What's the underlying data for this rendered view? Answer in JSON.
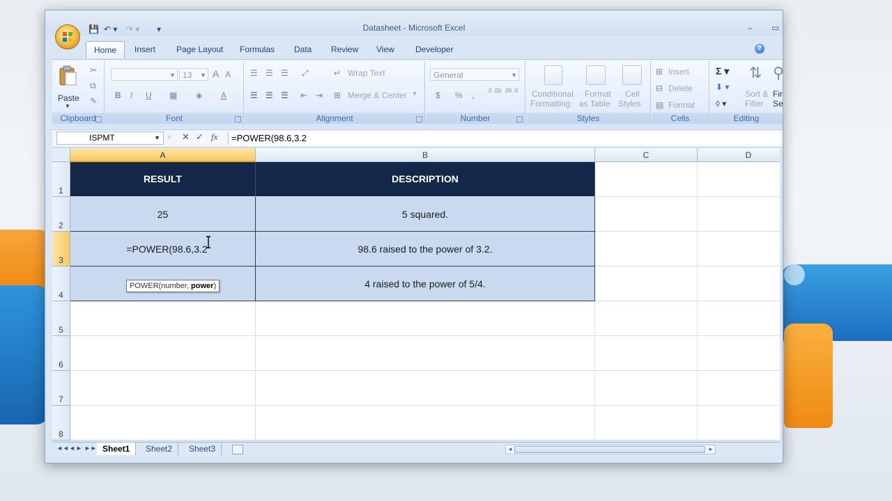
{
  "window": {
    "title": "Datasheet - Microsoft Excel",
    "minimize": "–",
    "maximize": "▭"
  },
  "qat": {
    "save": "💾",
    "undo": "↶ ▾",
    "redo": "↷ ▾",
    "more": "▾"
  },
  "tabs": [
    "Home",
    "Insert",
    "Page Layout",
    "Formulas",
    "Data",
    "Review",
    "View",
    "Developer"
  ],
  "help": "?",
  "ribbon": {
    "clipboard": {
      "label": "Clipboard",
      "paste": "Paste"
    },
    "font": {
      "label": "Font",
      "size": "13",
      "bold": "B",
      "italic": "I",
      "underline": "U",
      "grow": "A",
      "shrink": "A",
      "color": "A"
    },
    "alignment": {
      "label": "Alignment",
      "wrap_text": "Wrap Text",
      "merge_center": "Merge & Center"
    },
    "number": {
      "label": "Number",
      "format": "General",
      "currency": "$",
      "percent": "%",
      "comma": ",",
      "inc_dec": ".0 .00",
      "dec_dec": ".00 .0"
    },
    "styles": {
      "label": "Styles",
      "conditional": [
        "Conditional",
        "Formatting"
      ],
      "format_table": [
        "Format",
        "as Table"
      ],
      "cell_styles": [
        "Cell",
        "Styles"
      ]
    },
    "cells": {
      "label": "Cells",
      "insert": "Insert",
      "delete": "Delete",
      "format": "Format"
    },
    "editing": {
      "label": "Editing",
      "sort_filter": [
        "Sort &",
        "Filter"
      ],
      "find": [
        "Find",
        "Sele"
      ]
    }
  },
  "formula_bar": {
    "name_box": "ISPMT",
    "cancel": "✕",
    "enter": "✓",
    "fx": "fx",
    "content": "=POWER(98.6,3.2"
  },
  "columns": [
    "A",
    "B",
    "C",
    "D"
  ],
  "rows": [
    "1",
    "2",
    "3",
    "4",
    "5",
    "6",
    "7",
    "8"
  ],
  "table": {
    "headers": [
      "RESULT",
      "DESCRIPTION"
    ],
    "rows": [
      [
        "25",
        "5 squared."
      ],
      [
        "=POWER(98.6,3.2",
        "98.6 raised to the power of 3.2."
      ],
      [
        "",
        "4 raised to the power of 5/4."
      ]
    ]
  },
  "tooltip": {
    "prefix": "POWER(number, ",
    "bold": "power",
    "suffix": ")"
  },
  "sheets": [
    "Sheet1",
    "Sheet2",
    "Sheet3"
  ],
  "sheet_nav": [
    "◄◄",
    "◄",
    "►",
    "►►"
  ]
}
